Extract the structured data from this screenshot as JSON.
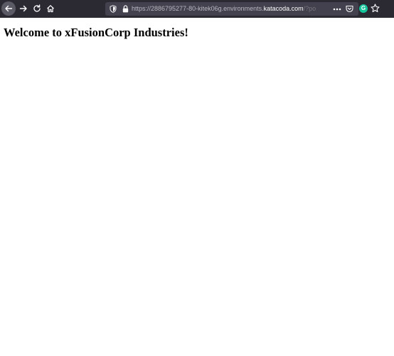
{
  "browser": {
    "url": {
      "prefix": "https://2886795277-80-kitek06g.environments.",
      "domain": "katacoda.com",
      "suffix": "/?po"
    },
    "extension": {
      "grammarly_letter": "G"
    },
    "colors": {
      "toolbar": "#2b2a33",
      "urlbar": "#42414d",
      "grammarly": "#15c39a"
    }
  },
  "page": {
    "heading": "Welcome to xFusionCorp Industries!"
  }
}
